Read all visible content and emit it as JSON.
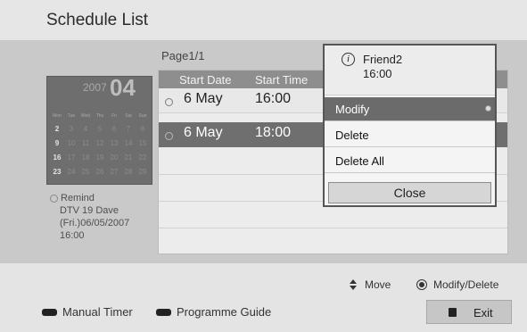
{
  "header": {
    "title": "Schedule List"
  },
  "calendar": {
    "year": "2007",
    "month": "04",
    "weekdays": [
      "Mon",
      "Tue",
      "Wed",
      "Thu",
      "Fri",
      "Sat",
      "Sun"
    ],
    "weeks": [
      [
        "2",
        "3",
        "4",
        "5",
        "6",
        "7",
        "8"
      ],
      [
        "9",
        "10",
        "11",
        "12",
        "13",
        "14",
        "15"
      ],
      [
        "16",
        "17",
        "18",
        "19",
        "20",
        "21",
        "22"
      ],
      [
        "23",
        "24",
        "25",
        "26",
        "27",
        "28",
        "29"
      ]
    ]
  },
  "remind": {
    "title": "Remind",
    "channel": "DTV 19 Dave",
    "date": "(Fri.)06/05/2007",
    "time": "16:00"
  },
  "list": {
    "page": "Page1/1",
    "headers": {
      "start_date": "Start Date",
      "start_time": "Start Time"
    },
    "rows": [
      {
        "date": "6 May",
        "time": "16:00"
      },
      {
        "date": "6 May",
        "time": "18:00"
      }
    ]
  },
  "popup": {
    "info_icon": "i",
    "info_name": "Friend2",
    "info_time": "16:00",
    "items": {
      "modify": "Modify",
      "delete": "Delete",
      "delete_all": "Delete All"
    },
    "close": "Close"
  },
  "footer": {
    "move": "Move",
    "modify_delete": "Modify/Delete",
    "manual_timer": "Manual Timer",
    "programme_guide": "Programme Guide",
    "exit": "Exit"
  },
  "icons": [
    "clock-icon",
    "info-icon",
    "up-down-arrow-icon",
    "ok-button-icon",
    "red-key-icon",
    "exit-key-icon"
  ]
}
